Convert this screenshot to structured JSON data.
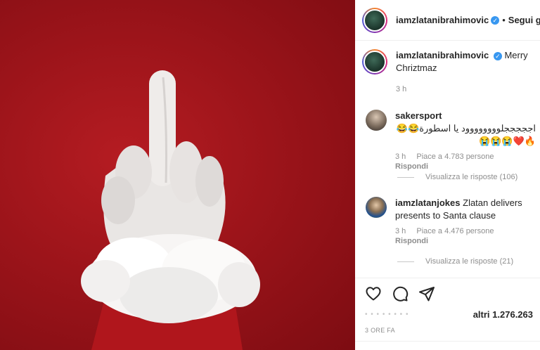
{
  "post": {
    "author": "iamzlatanibrahimovic",
    "follow_label": "Segui già",
    "dot": "•",
    "caption": "Merry Chriztmaz",
    "caption_time": "3 h",
    "verified_glyph": "✓"
  },
  "comments": [
    {
      "user": "sakersport",
      "text": "اجججججلوووووووود يا اسطورة😂😂🔥❤️😭😭😭",
      "time": "3 h",
      "likes": "Piace a 4.783 persone",
      "reply": "Rispondi",
      "view_replies": "Visualizza le risposte (106)"
    },
    {
      "user": "iamzlatanjokes",
      "text": "Zlatan delivers presents to Santa clause",
      "time": "3 h",
      "likes": "Piace a 4.476 persone",
      "reply": "Rispondi",
      "view_replies": "Visualizza le risposte (21)"
    }
  ],
  "footer": {
    "likes_prefix": "• • •  • •   • • •",
    "likes_count": "altri 1.276.263",
    "posted_ago": "3 ORE FA"
  },
  "icons": {
    "like": "heart-icon",
    "comment": "comment-icon",
    "share": "share-icon"
  },
  "colors": {
    "photo_background": "#9c141a",
    "verified": "#3897f0",
    "text_primary": "#262626",
    "text_secondary": "#8e8e8e"
  }
}
